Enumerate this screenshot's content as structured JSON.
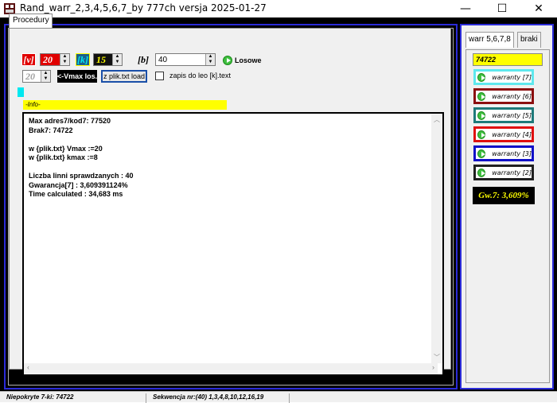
{
  "window": {
    "title": "Rand_warr_2,3,4,5,6,7_by 777ch  versja 2025-01-27",
    "minimize": "—",
    "maximize": "☐",
    "close": "✕"
  },
  "left": {
    "tab_label": "Procedury",
    "v_label": "[v]",
    "v_value": "20",
    "k_label": "[k]",
    "k_value": "15",
    "b_label": "[b]",
    "b_value": "40",
    "losowe_label": "Losowe",
    "vmax_value": "20",
    "vmax_btn": "<-Vmax los.",
    "load_btn": "z plik.txt load",
    "save_checkbox_label": "zapis do leo [k].text",
    "save_checked": false,
    "info_label": "-Info-",
    "info_text": "Max adres7/kod7: 77520\nBrak7: 74722\n\nw {plik.txt} Vmax :=20\nw {plik.txt} kmax :=8\n\nLiczba linni sprawdzanych : 40\nGwarancja[7] : 3,609391124%\nTime calculated : 34,683 ms"
  },
  "right": {
    "tab_warr": "warr 5,6,7,8",
    "tab_braki": "braki",
    "value_box": "74722",
    "buttons": [
      {
        "label": "warranty [7]",
        "color": "#5ee8ee"
      },
      {
        "label": "warranty [6]",
        "color": "#8b0f0f"
      },
      {
        "label": "warranty [5]",
        "color": "#1e7a7a"
      },
      {
        "label": "warranty [4]",
        "color": "#e01010"
      },
      {
        "label": "warranty [3]",
        "color": "#1010c8"
      },
      {
        "label": "warranty [2]",
        "color": "#202020"
      }
    ],
    "gw_text": "Gw.7: 3,609%"
  },
  "status": {
    "left": "Niepokryte 7-ki: 74722",
    "right": "Sekwencja nr:(40)  1,3,4,8,10,12,16,19"
  },
  "colors": {
    "accent_blue": "#2b2bd9",
    "yellow": "#ffff00",
    "red": "#e00000",
    "cyan": "#00e8f0"
  }
}
